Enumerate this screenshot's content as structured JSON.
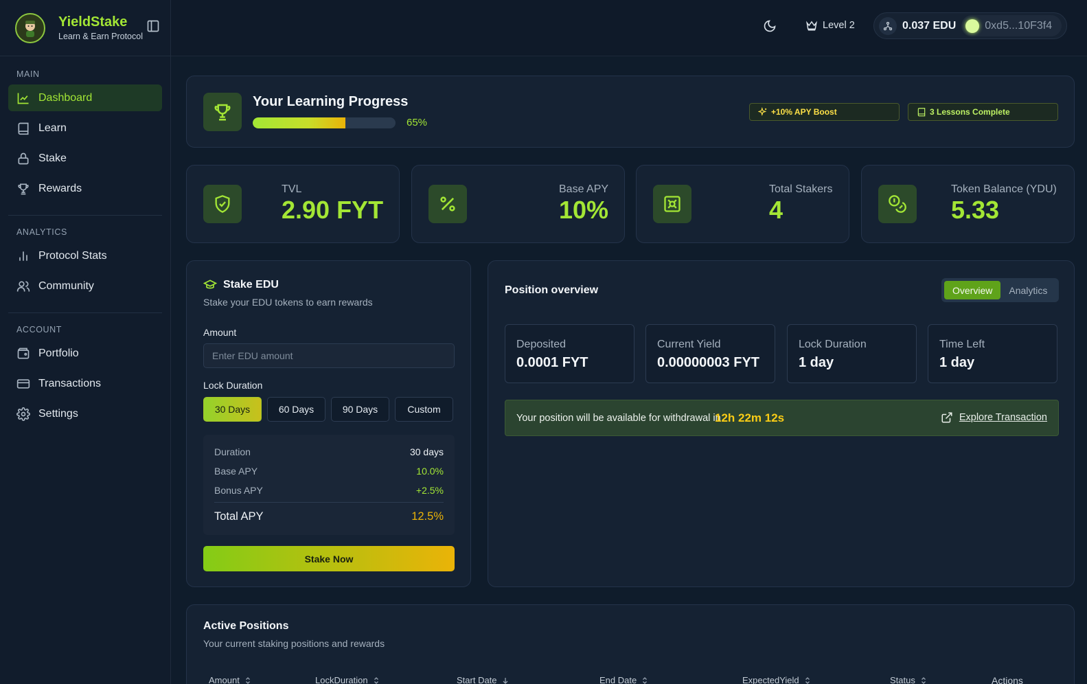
{
  "brand": {
    "name": "YieldStake",
    "tagline": "Learn & Earn Protocol"
  },
  "sidebar": {
    "sections": [
      {
        "heading": "MAIN",
        "items": [
          {
            "label": "Dashboard",
            "icon": "chart-line-icon",
            "active": true
          },
          {
            "label": "Learn",
            "icon": "book-icon"
          },
          {
            "label": "Stake",
            "icon": "lock-icon"
          },
          {
            "label": "Rewards",
            "icon": "trophy-icon"
          }
        ]
      },
      {
        "heading": "ANALYTICS",
        "items": [
          {
            "label": "Protocol Stats",
            "icon": "bar-chart-icon"
          },
          {
            "label": "Community",
            "icon": "users-icon"
          }
        ]
      },
      {
        "heading": "ACCOUNT",
        "items": [
          {
            "label": "Portfolio",
            "icon": "wallet-icon"
          },
          {
            "label": "Transactions",
            "icon": "credit-card-icon"
          },
          {
            "label": "Settings",
            "icon": "gear-icon"
          }
        ]
      }
    ]
  },
  "header": {
    "level": "Level 2",
    "balance": "0.037 EDU",
    "address": "0xd5...10F3f4"
  },
  "learning": {
    "title": "Your Learning Progress",
    "progress_pct": 65,
    "progress_label": "65%",
    "boost_badge": "+10% APY Boost",
    "lessons_badge": "3 Lessons Complete"
  },
  "stats": [
    {
      "label": "TVL",
      "value": "2.90 FYT",
      "icon": "shield-check-icon"
    },
    {
      "label": "Base APY",
      "value": "10%",
      "icon": "percent-icon"
    },
    {
      "label": "Total Stakers",
      "value": "4",
      "icon": "vault-icon"
    },
    {
      "label": "Token Balance (YDU)",
      "value": "5.33",
      "icon": "coins-icon"
    }
  ],
  "stake_form": {
    "title": "Stake EDU",
    "subtitle": "Stake your EDU tokens to earn rewards",
    "amount_label": "Amount",
    "amount_placeholder": "Enter EDU amount",
    "lock_label": "Lock Duration",
    "durations": [
      "30 Days",
      "60 Days",
      "90 Days",
      "Custom"
    ],
    "selected_duration": "30 Days",
    "summary": {
      "duration_label": "Duration",
      "duration_value": "30 days",
      "base_label": "Base APY",
      "base_value": "10.0%",
      "bonus_label": "Bonus APY",
      "bonus_value": "+2.5%",
      "total_label": "Total APY",
      "total_value": "12.5%"
    },
    "submit_label": "Stake Now"
  },
  "position": {
    "title": "Position overview",
    "tabs": [
      "Overview",
      "Analytics"
    ],
    "active_tab": "Overview",
    "metrics": [
      {
        "label": "Deposited",
        "value": "0.0001 FYT"
      },
      {
        "label": "Current Yield",
        "value": "0.00000003 FYT"
      },
      {
        "label": "Lock Duration",
        "value": "1 day"
      },
      {
        "label": "Time Left",
        "value": "1 day"
      }
    ],
    "withdraw_msg": "Your position will be available for withdrawal in",
    "withdraw_timer": "12h 22m 12s",
    "explore_label": "Explore Transaction"
  },
  "active_positions": {
    "title": "Active Positions",
    "subtitle": "Your current staking positions and rewards",
    "columns": [
      {
        "label": "Amount",
        "sort": "both"
      },
      {
        "label": "LockDuration",
        "sort": "both"
      },
      {
        "label": "Start Date",
        "sort": "desc"
      },
      {
        "label": "End Date",
        "sort": "both"
      },
      {
        "label": "ExpectedYield",
        "sort": "both"
      },
      {
        "label": "Status",
        "sort": "both"
      },
      {
        "label": "Actions",
        "sort": "none"
      }
    ]
  },
  "colors": {
    "accent": "#a3e635",
    "gold": "#eab308",
    "background": "#0f1c2b",
    "card": "#152233"
  }
}
